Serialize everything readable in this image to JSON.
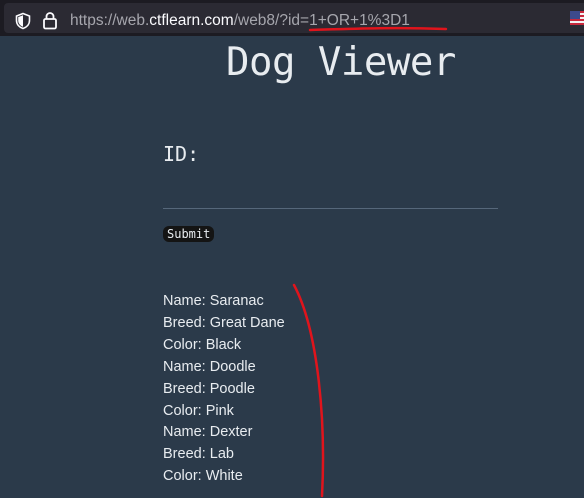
{
  "browser": {
    "url_prefix": "https://web.",
    "url_domain": "ctflearn.com",
    "url_path": "/web8/?id=1+OR+1%3D1"
  },
  "page": {
    "title": "Dog Viewer",
    "id_label": "ID:",
    "id_value": "",
    "submit_label": "Submit"
  },
  "results": [
    "Name: Saranac",
    "Breed: Great Dane",
    "Color: Black",
    "Name: Doodle",
    "Breed: Poodle",
    "Color: Pink",
    "Name: Dexter",
    "Breed: Lab",
    "Color: White"
  ],
  "colors": {
    "page_background": "#2b3a4a",
    "text": "#e8ecf0",
    "annotation_red": "#e0141c"
  }
}
